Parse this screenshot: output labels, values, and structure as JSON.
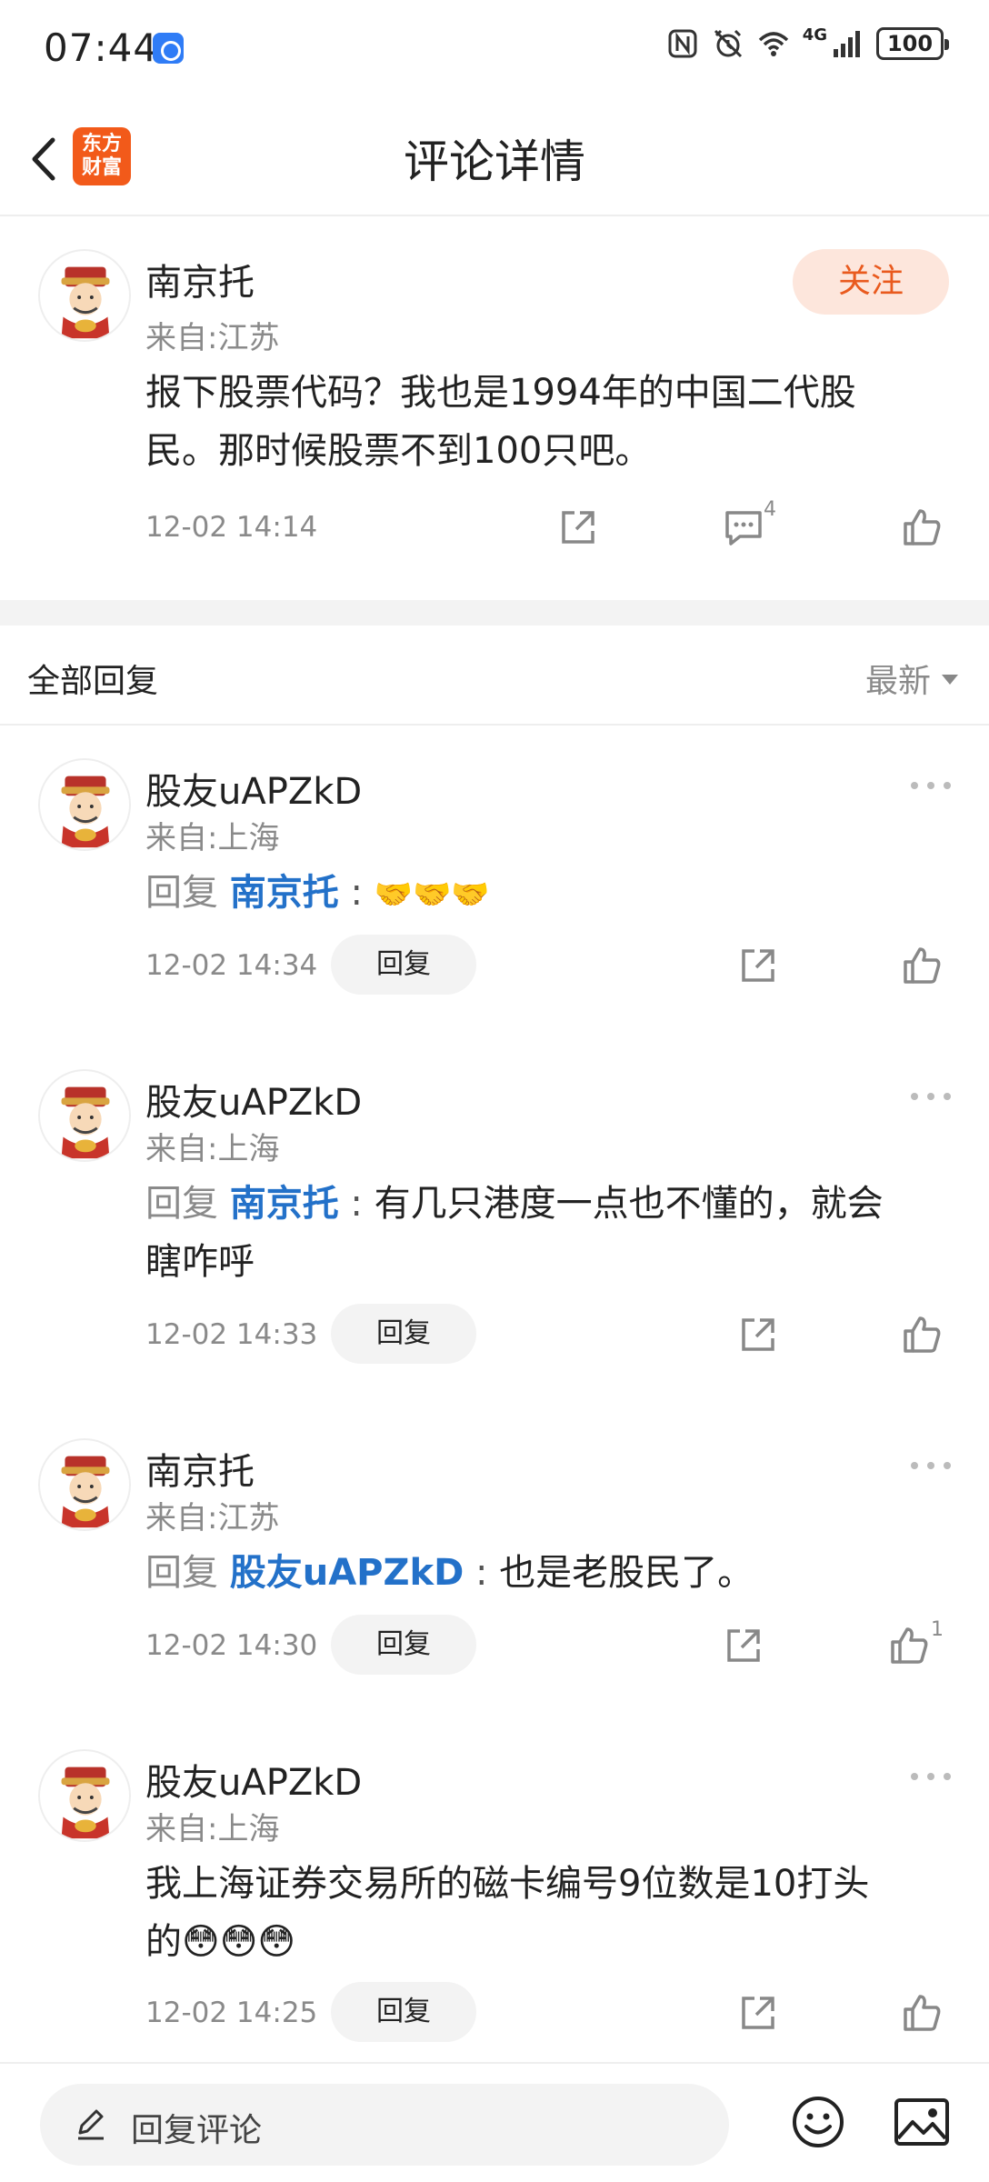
{
  "status_bar": {
    "time": "07:44",
    "network": "4G",
    "battery": "100"
  },
  "nav": {
    "title": "评论详情",
    "logo_line1": "东方",
    "logo_line2": "财富"
  },
  "main_comment": {
    "user": "南京托",
    "location": "来自:江苏",
    "content_line1": "报下股票代码？我也是1994年的中国二代股",
    "content_line2": "民。那时候股票不到100只吧。",
    "time": "12-02 14:14",
    "follow_label": "关注",
    "comment_count": "4"
  },
  "replies_header": {
    "title": "全部回复",
    "sort": "最新"
  },
  "reply_prefix": "回复",
  "reply_button_label": "回复",
  "replies": [
    {
      "user": "股友uAPZkD",
      "location": "来自:上海",
      "target": "南京托",
      "content": "🤝🤝🤝",
      "time": "12-02 14:34"
    },
    {
      "user": "股友uAPZkD",
      "location": "来自:上海",
      "target": "南京托",
      "content_line1": "有几只港度一点也不懂的，就会",
      "content_line2": "瞎咋呼",
      "time": "12-02 14:33"
    },
    {
      "user": "南京托",
      "location": "来自:江苏",
      "target": "股友uAPZkD",
      "content": "也是老股民了。",
      "time": "12-02 14:30",
      "like_count": "1"
    },
    {
      "user": "股友uAPZkD",
      "location": "来自:上海",
      "content_line1": "我上海证券交易所的磁卡编号9位数是10打头",
      "content_line2": "的😳😳😳",
      "time": "12-02 14:25"
    }
  ],
  "bottom_bar": {
    "input_label": "回复评论"
  }
}
